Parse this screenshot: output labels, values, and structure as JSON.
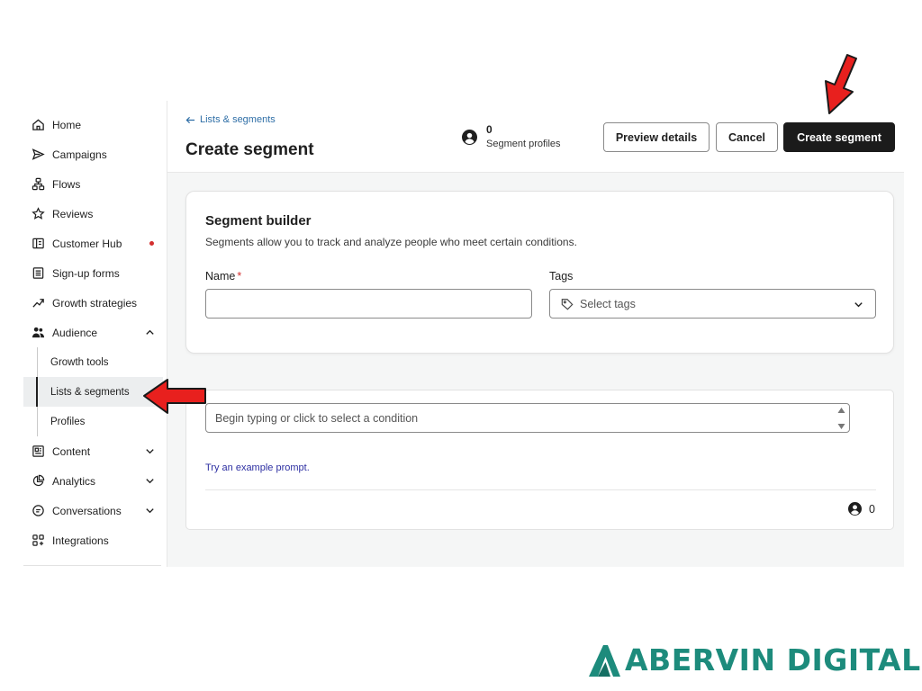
{
  "sidebar": {
    "items": [
      {
        "label": "Home",
        "icon": "home-icon"
      },
      {
        "label": "Campaigns",
        "icon": "send-icon"
      },
      {
        "label": "Flows",
        "icon": "flows-icon"
      },
      {
        "label": "Reviews",
        "icon": "star-icon"
      },
      {
        "label": "Customer Hub",
        "icon": "customer-hub-icon"
      },
      {
        "label": "Sign-up forms",
        "icon": "form-icon"
      },
      {
        "label": "Growth strategies",
        "icon": "trend-up-icon"
      },
      {
        "label": "Audience",
        "icon": "people-icon"
      },
      {
        "label": "Content",
        "icon": "content-icon"
      },
      {
        "label": "Analytics",
        "icon": "pie-chart-icon"
      },
      {
        "label": "Conversations",
        "icon": "chat-icon"
      },
      {
        "label": "Integrations",
        "icon": "grid-plus-icon"
      }
    ],
    "audience_sub": [
      {
        "label": "Growth tools"
      },
      {
        "label": "Lists & segments"
      },
      {
        "label": "Profiles"
      }
    ],
    "notification_color": "#d32f2f"
  },
  "header": {
    "back_label": "Lists & segments",
    "title": "Create segment",
    "profile_count": "0",
    "profile_label": "Segment profiles",
    "preview_label": "Preview details",
    "cancel_label": "Cancel",
    "create_label": "Create segment"
  },
  "builder": {
    "title": "Segment builder",
    "description": "Segments allow you to track and analyze people who meet certain conditions.",
    "name_label": "Name",
    "name_required_mark": "*",
    "name_value": "",
    "tags_label": "Tags",
    "tags_placeholder": "Select tags"
  },
  "conditions": {
    "placeholder": "Begin typing or click to select a condition",
    "example_link": "Try an example prompt.",
    "count": "0"
  },
  "logo": {
    "text": "ABERVIN DIGITAL",
    "color": "#1d8b7c"
  },
  "colors": {
    "primary_button": "#1b1b1b",
    "link": "#2e6ea6",
    "annotation_arrow": "#e8201e"
  }
}
